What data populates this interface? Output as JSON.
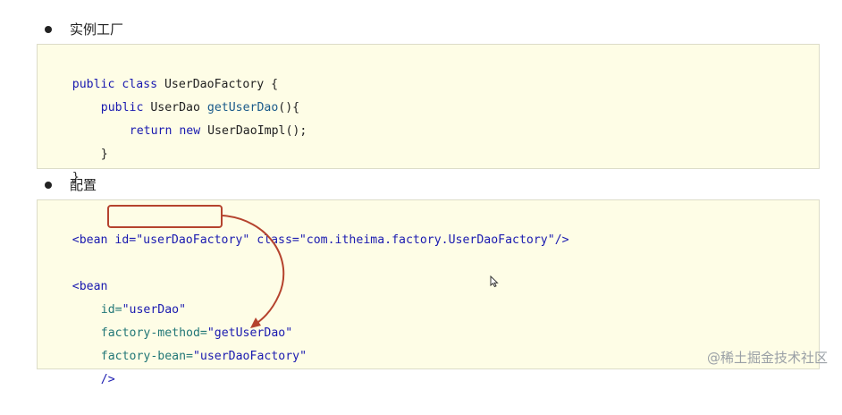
{
  "bullets": {
    "instance_factory": "实例工厂",
    "config": "配置"
  },
  "code1": {
    "l1_kw": "public class",
    "l1_name": " UserDaoFactory {",
    "l2_kw": "public",
    "l2_type": " UserDao ",
    "l2_method": "getUserDao",
    "l2_rest": "(){",
    "l3_kw": "return new",
    "l3_rest": " UserDaoImpl();",
    "l4": "}",
    "l5": "}"
  },
  "code2": {
    "l1_open": "<bean id=",
    "l1_id": "\"userDaoFactory\"",
    "l1_class_attr": " class=",
    "l1_class_val": "\"com.itheima.factory.UserDaoFactory\"",
    "l1_close": "/>",
    "l2": "<bean",
    "l3_attr": "id=",
    "l3_val": "\"userDao\"",
    "l4_attr": "factory-method=",
    "l4_val": "\"getUserDao\"",
    "l5_attr": "factory-bean=",
    "l5_val": "\"userDaoFactory\"",
    "l6": "/>"
  },
  "watermark": "@稀土掘金技术社区",
  "colors": {
    "code_bg": "#fefde6",
    "highlight": "#b5432e"
  },
  "icons": [
    "mouse-cursor-icon",
    "curved-arrow-icon"
  ]
}
